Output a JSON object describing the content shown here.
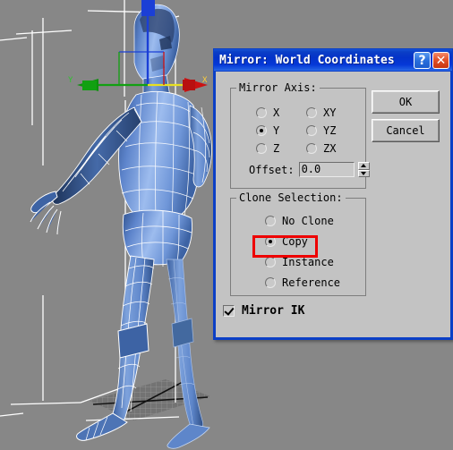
{
  "viewport": {
    "name": "3d-viewport",
    "background_color": "#878787",
    "mesh_color": "#6d93d6",
    "wireframe_color": "#ffffff",
    "gizmo": {
      "x_axis_label": "X",
      "y_axis_label": "Y",
      "x_axis_color": "#d01515",
      "y_axis_color": "#11a011",
      "z_axis_color": "#1b3fd6"
    }
  },
  "dialog": {
    "title": "Mirror: World Coordinates",
    "title_bar_color": "#0433c9",
    "help_button_label": "?",
    "close_button_label": "✕",
    "mirror_axis": {
      "group_label": "Mirror Axis:",
      "options": [
        {
          "label": "X",
          "checked": false
        },
        {
          "label": "Y",
          "checked": true
        },
        {
          "label": "Z",
          "checked": false
        },
        {
          "label": "XY",
          "checked": false
        },
        {
          "label": "YZ",
          "checked": false
        },
        {
          "label": "ZX",
          "checked": false
        }
      ],
      "offset_label": "Offset:",
      "offset_value": "0.0"
    },
    "clone_selection": {
      "group_label": "Clone Selection:",
      "options": [
        {
          "label": "No Clone",
          "checked": false
        },
        {
          "label": "Copy",
          "checked": true
        },
        {
          "label": "Instance",
          "checked": false
        },
        {
          "label": "Reference",
          "checked": false
        }
      ]
    },
    "mirror_ik": {
      "label": "Mirror IK",
      "checked": true
    },
    "buttons": {
      "ok": "OK",
      "cancel": "Cancel"
    }
  },
  "annotation": {
    "target": "Copy",
    "color": "#ee0000"
  }
}
